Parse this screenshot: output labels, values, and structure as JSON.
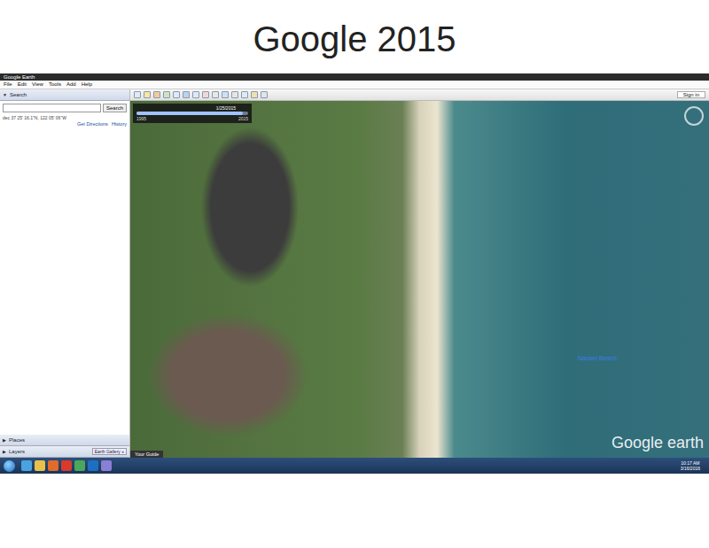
{
  "slide": {
    "title": "Google 2015"
  },
  "window": {
    "title": "Google Earth"
  },
  "menu": [
    "File",
    "Edit",
    "View",
    "Tools",
    "Add",
    "Help"
  ],
  "sign_in": "Sign in",
  "search": {
    "header": "Search",
    "button": "Search",
    "coords": "dec 37 25' 16.1\"N, 122 05' 06\"W",
    "links": [
      "Get Directions",
      "History"
    ]
  },
  "panels": [
    {
      "label": "Places",
      "icon": "▶",
      "expanded": false
    },
    {
      "label": "Layers",
      "icon": "▶",
      "expanded": false
    }
  ],
  "earth_gallery": "Earth Gallery »",
  "time_slider": {
    "date": "1/25/2015",
    "start": "1995",
    "end": "2015",
    "level": 0.95
  },
  "tour_guide": "Your Guide",
  "map": {
    "label": "Nauset Beach",
    "watermark": "Google earth"
  },
  "taskbar": {
    "time": "10:17 AM",
    "date": "3/16/2016"
  }
}
